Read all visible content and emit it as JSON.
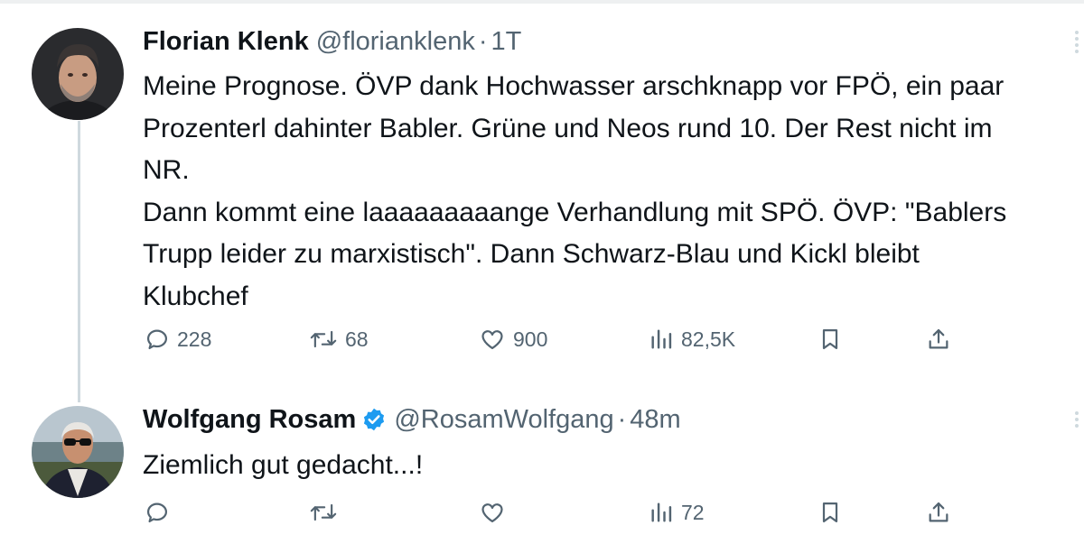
{
  "tweets": [
    {
      "name": "Florian Klenk",
      "handle": "@florianklenk",
      "separator": "·",
      "time": "1T",
      "lines": [
        "Meine Prognose. ÖVP dank Hochwasser arschknapp vor FPÖ, ein paar",
        "Prozenterl dahinter Babler. Grüne und Neos rund 10. Der Rest nicht im",
        "NR.",
        "Dann kommt eine laaaaaaaaange Verhandlung mit SPÖ. ÖVP: \"Bablers",
        "Trupp leider zu marxistisch\".  Dann Schwarz-Blau und Kickl bleibt",
        "Klubchef"
      ],
      "actions": {
        "replies": "228",
        "retweets": "68",
        "likes": "900",
        "views": "82,5K"
      }
    },
    {
      "name": "Wolfgang Rosam",
      "handle": "@RosamWolfgang",
      "separator": "·",
      "time": "48m",
      "verified": true,
      "lines": [
        "Ziemlich gut gedacht...!"
      ],
      "actions": {
        "replies": "",
        "retweets": "",
        "likes": "",
        "views": "72"
      }
    }
  ],
  "icons": {
    "reply": "speech-bubble-icon",
    "retweet": "retweet-arrows-icon",
    "like": "heart-icon",
    "views": "bar-chart-icon",
    "bookmark": "bookmark-icon",
    "share": "share-upload-icon",
    "verified": "verified-badge-icon",
    "more": "more-dots-icon"
  },
  "colors": {
    "verified_blue": "#1d9bf0",
    "secondary_text": "#536471",
    "thread_line": "#cfd9de"
  }
}
